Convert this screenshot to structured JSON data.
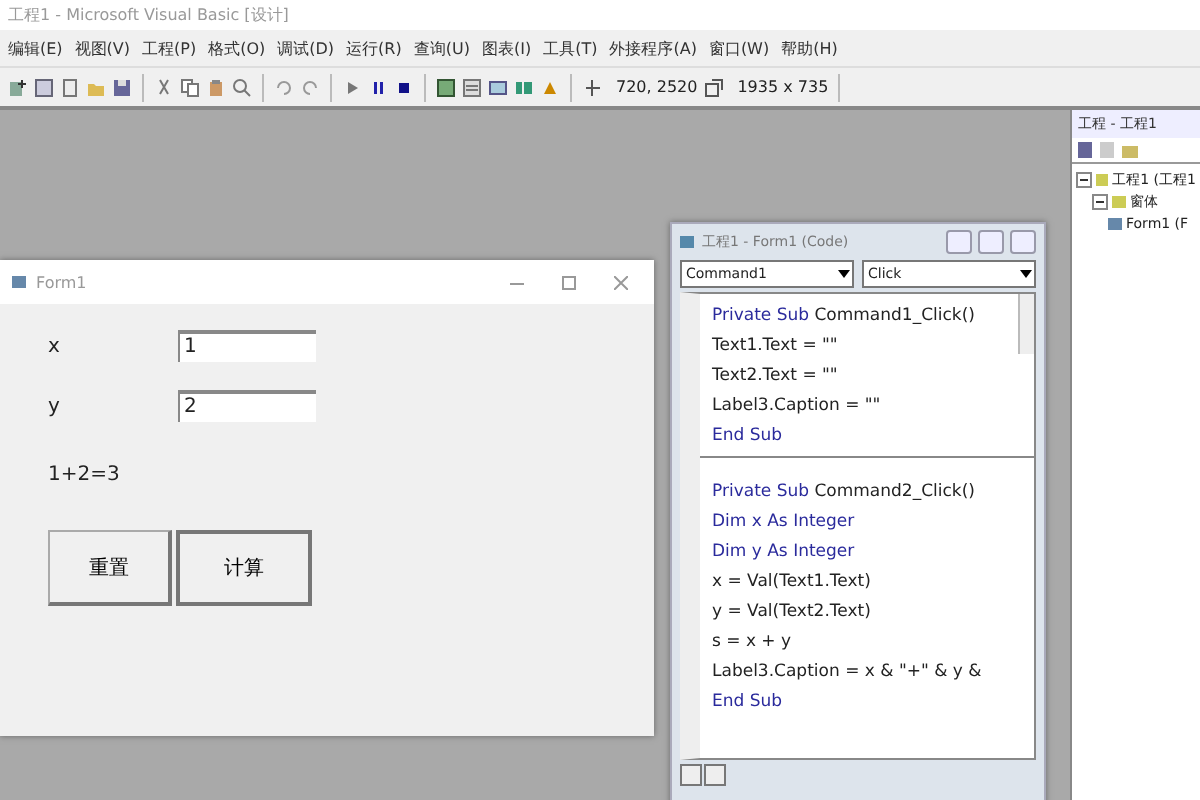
{
  "window": {
    "title": "工程1 - Microsoft Visual Basic [设计]"
  },
  "menu": [
    "编辑(E)",
    "视图(V)",
    "工程(P)",
    "格式(O)",
    "调试(D)",
    "运行(R)",
    "查询(U)",
    "图表(I)",
    "工具(T)",
    "外接程序(A)",
    "窗口(W)",
    "帮助(H)"
  ],
  "toolbar": {
    "position": "720, 2520",
    "size": "1935 x 735"
  },
  "form_window": {
    "title": "Form1",
    "fields": [
      {
        "label": "x",
        "value": "1"
      },
      {
        "label": "y",
        "value": "2"
      }
    ],
    "result": "1+2=3",
    "buttons": [
      "重置",
      "计算"
    ]
  },
  "code_window": {
    "title": "工程1 - Form1 (Code)",
    "object": "Command1",
    "procedure": "Click",
    "procedures": [
      [
        {
          "keyword": "Private Sub",
          "code": "Command1_Click()"
        },
        {
          "code": "Text1.Text = \"\""
        },
        {
          "code": "Text2.Text = \"\""
        },
        {
          "code": "Label3.Caption = \"\""
        },
        {
          "keyword": "End Sub"
        }
      ],
      [
        {
          "keyword": "Private Sub",
          "code": "Command2_Click()"
        },
        {
          "keyword": "Dim x As Integer"
        },
        {
          "keyword": "Dim y As Integer"
        },
        {
          "code": "x = Val(Text1.Text)"
        },
        {
          "code": "y = Val(Text2.Text)"
        },
        {
          "code": "s = x + y"
        },
        {
          "code": "Label3.Caption = x & \"+\" & y &"
        },
        {
          "keyword": "End Sub"
        }
      ]
    ]
  },
  "project_panel": {
    "title": "工程 - 工程1",
    "tree": [
      {
        "label": "工程1 (工程1",
        "expanded": true,
        "children": [
          {
            "label": "窗体",
            "expanded": true,
            "children": [
              {
                "label": "Form1 (F"
              }
            ]
          }
        ]
      }
    ]
  }
}
